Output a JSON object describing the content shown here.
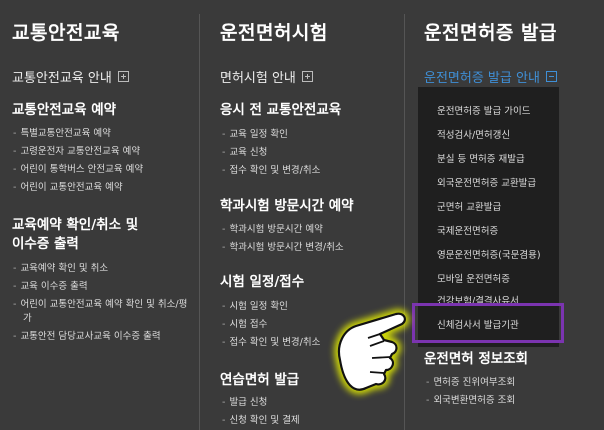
{
  "col1": {
    "title": "교통안전교육",
    "toggle": "교통안전교육 안내",
    "sec1_title": "교통안전교육 예약",
    "sec1_items": [
      "특별교통안전교육 예약",
      "고령운전자 교통안전교육 예약",
      "어린이 통학버스 안전교육 예약",
      "어린이 교통안전교육 예약"
    ],
    "sec2_title_l1": "교육예약 확인/취소 및",
    "sec2_title_l2": "이수증 출력",
    "sec2_items": [
      "교육예약 확인 및 취소",
      "교육 이수증 출력",
      "어린이 교통안전교육 예약 확인 및 취소/평가",
      "교통안전 담당교사교육 이수증 출력"
    ]
  },
  "col2": {
    "title": "운전면허시험",
    "toggle": "면허시험 안내",
    "sec1_title": "응시 전 교통안전교육",
    "sec1_items": [
      "교육 일정 확인",
      "교육 신청",
      "접수 확인 및 변경/취소"
    ],
    "sec2_title": "학과시험 방문시간 예약",
    "sec2_items": [
      "학과시험 방문시간 예약",
      "학과시험 방문시간 변경/취소"
    ],
    "sec3_title": "시험 일정/접수",
    "sec3_items": [
      "시험 일정 확인",
      "시험 접수",
      "접수 확인 및 변경/취소"
    ],
    "sec4_title": "연습면허 발급",
    "sec4_items": [
      "발급 신청",
      "신청 확인 및 결제"
    ]
  },
  "col3": {
    "title": "운전면허증 발급",
    "toggle": "운전면허증 발급 안내",
    "dropdown_items": [
      "운전면허증 발급 가이드",
      "적성검사/면허갱신",
      "분실 등 면허증 재발급",
      "외국운전면허증 교환발급",
      "군면허 교환발급",
      "국제운전면허증",
      "영문운전면허증(국문겸용)",
      "모바일 운전면허증",
      "건강보험/결격사유서",
      "신체검사서 발급기관"
    ],
    "sec_title": "운전면허 정보조회",
    "sec_items": [
      "면허증 진위여부조회",
      "외국변환면허증 조회"
    ]
  },
  "colors": {
    "accent": "#3f8fd6",
    "highlight": "#7b34b0",
    "background": "#3a3a3a",
    "dropdown_bg": "#1f1f1f"
  }
}
